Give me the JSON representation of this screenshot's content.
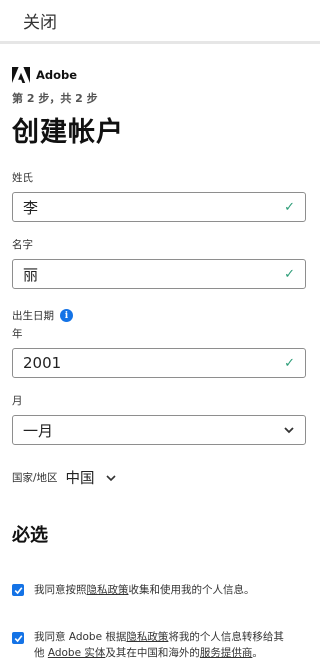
{
  "header": {
    "close_label": "关闭"
  },
  "brand": {
    "name": "Adobe",
    "logo_icon": "adobe-logo-icon"
  },
  "step_text": "第 2 步，共 2 步",
  "title": "创建帐户",
  "surname": {
    "label": "姓氏",
    "value": "李"
  },
  "given_name": {
    "label": "名字",
    "value": "丽"
  },
  "dob": {
    "label": "出生日期",
    "info_icon": "i",
    "year_label": "年",
    "year_value": "2001",
    "month_label": "月",
    "month_value": "一月"
  },
  "region": {
    "label": "国家/地区",
    "value": "中国"
  },
  "required": {
    "title": "必选"
  },
  "consents": [
    {
      "checked": true,
      "t1": "我同意按照",
      "l1": "隐私政策",
      "t2": "收集和使用我的个人信息。"
    },
    {
      "checked": true,
      "t1": "我同意 Adobe 根据",
      "l1": "隐私政策",
      "t2": "将我的个人信息转移给其他 ",
      "l2": "Adobe 实体",
      "t3": "及其在中国和海外的",
      "l3": "服务提供商",
      "t4": "。"
    }
  ],
  "colors": {
    "accent": "#1473e6",
    "valid": "#2d9d78",
    "border": "#8e8e8e"
  }
}
